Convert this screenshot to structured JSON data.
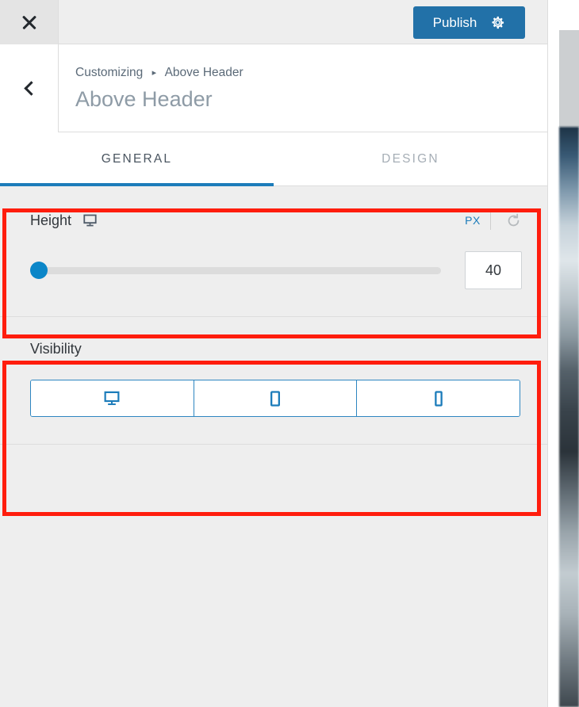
{
  "topbar": {
    "close_icon": "close-x-icon",
    "publish_label": "Publish",
    "gear_icon": "gear-icon"
  },
  "titlebar": {
    "back_icon": "chevron-left-icon",
    "breadcrumb_root": "Customizing",
    "breadcrumb_separator": "▸",
    "breadcrumb_current": "Above Header",
    "title": "Above Header"
  },
  "tabs": [
    {
      "label": "GENERAL",
      "active": true
    },
    {
      "label": "DESIGN",
      "active": false
    }
  ],
  "height_control": {
    "label": "Height",
    "device_icon": "desktop-icon",
    "unit": "PX",
    "reset_icon": "reset-icon",
    "value": "40",
    "slider_percent": 0
  },
  "visibility_control": {
    "label": "Visibility",
    "options": [
      {
        "icon": "desktop-icon",
        "name": "desktop"
      },
      {
        "icon": "tablet-icon",
        "name": "tablet"
      },
      {
        "icon": "mobile-icon",
        "name": "mobile"
      }
    ]
  },
  "colors": {
    "accent_blue": "#1c7cba",
    "publish_blue": "#2271a8",
    "slider_blue": "#0b86c8",
    "icon_blue": "#1c7cba",
    "annotation_red": "#ff1d0d",
    "panel_bg": "#eeeeee"
  }
}
